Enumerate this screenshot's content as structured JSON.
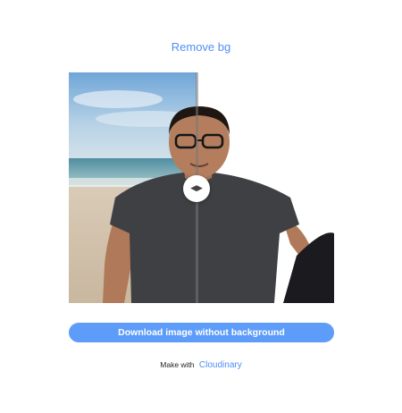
{
  "header": {
    "title": "Remove bg"
  },
  "comparison": {
    "handle_icon": "left-right-arrows-icon",
    "divider_position": 0.48
  },
  "actions": {
    "download_label": "Download image without background"
  },
  "footer": {
    "prefix": "Make with",
    "brand": "Cloudinary"
  },
  "colors": {
    "accent": "#5d9cf8",
    "link": "#4f8ff7"
  }
}
